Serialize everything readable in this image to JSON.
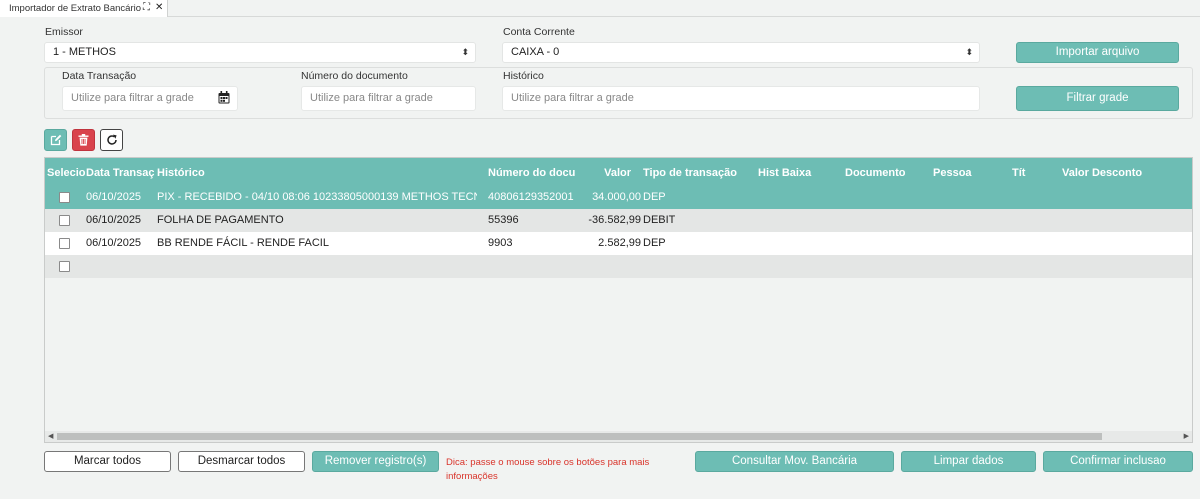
{
  "tab": {
    "title": "Importador de Extrato Bancário",
    "maximize_icon": "⛶",
    "close_icon": "✕"
  },
  "form": {
    "emissor": {
      "label": "Emissor",
      "value": "1 - METHOS"
    },
    "conta": {
      "label": "Conta Corrente",
      "value": "CAIXA - 0"
    },
    "import_button": "Importar arquivo"
  },
  "filters": {
    "data": {
      "label": "Data Transação",
      "placeholder": "Utilize para filtrar a grade"
    },
    "numero": {
      "label": "Número do documento",
      "placeholder": "Utilize para filtrar a grade"
    },
    "historico": {
      "label": "Histórico",
      "placeholder": "Utilize para filtrar a grade"
    },
    "filter_button": "Filtrar grade"
  },
  "toolbar": {
    "edit_icon": "edit-icon",
    "delete_icon": "trash-icon",
    "refresh_icon": "refresh-icon"
  },
  "grid": {
    "columns": [
      "Selecio",
      "Data Transaç",
      "Histórico",
      "Número do docu",
      "Valor",
      "Tipo de transação",
      "Hist Baixa",
      "Documento",
      "Pessoa",
      "Tít",
      "Valor Desconto"
    ],
    "rows": [
      {
        "data": "06/10/2025",
        "historico": "PIX - RECEBIDO - 04/10 08:06 10233805000139 METHOS TECN",
        "numero": "40806129352001",
        "valor": "34.000,00",
        "tipo": "DEP"
      },
      {
        "data": "06/10/2025",
        "historico": "FOLHA DE PAGAMENTO",
        "numero": "55396",
        "valor": "-36.582,99",
        "tipo": "DEBIT"
      },
      {
        "data": "06/10/2025",
        "historico": "BB RENDE FÁCIL - RENDE FACIL",
        "numero": "9903",
        "valor": "2.582,99",
        "tipo": "DEP"
      },
      {
        "data": "",
        "historico": "",
        "numero": "",
        "valor": "",
        "tipo": ""
      }
    ]
  },
  "footer": {
    "marcar": "Marcar todos",
    "desmarcar": "Desmarcar todos",
    "remover": "Remover registro(s)",
    "hint": "Dica: passe o mouse sobre os botões para mais informações",
    "consultar": "Consultar Mov. Bancária",
    "limpar": "Limpar dados",
    "confirmar": "Confirmar inclusao"
  },
  "colors": {
    "accent": "#6dbdb4",
    "danger": "#d9434d",
    "hint": "#d9342b"
  }
}
